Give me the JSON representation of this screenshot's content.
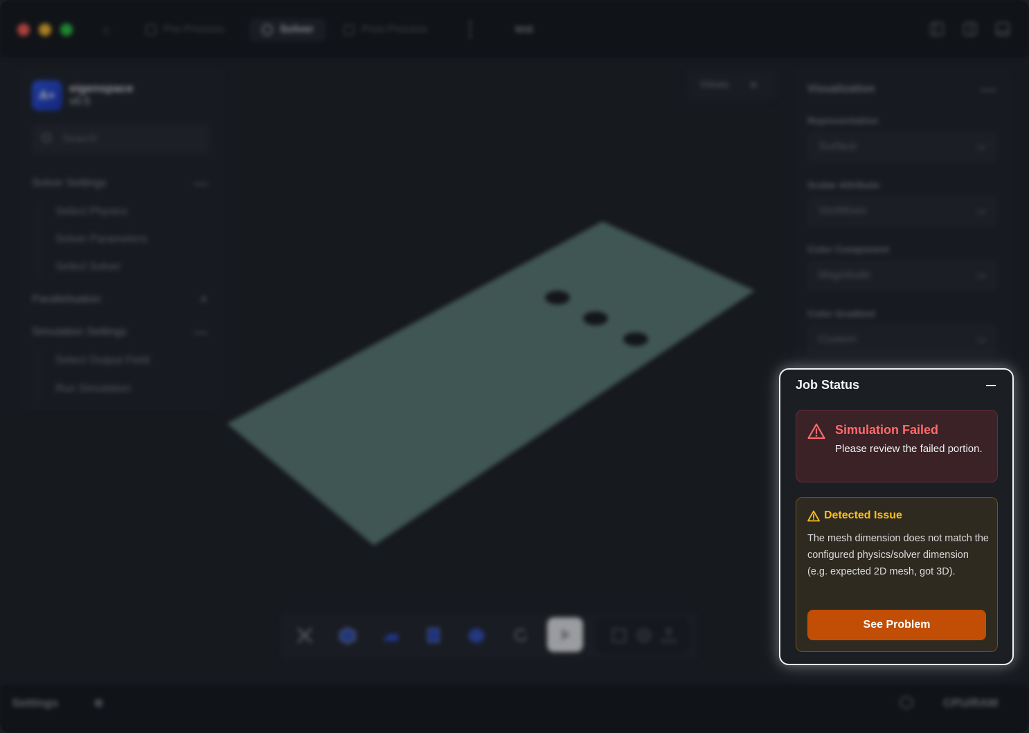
{
  "titlebar": {
    "tabs": [
      {
        "label": "Pre-Process"
      },
      {
        "label": "Solver"
      },
      {
        "label": "Post-Process"
      }
    ],
    "project_title": "test"
  },
  "sidebar": {
    "app_name": "eigenspace",
    "version": "v0.5",
    "logo_text": "A+",
    "search_placeholder": "Search",
    "sections": [
      {
        "title": "Solver Settings",
        "expanded": true,
        "items": [
          "Select Physics",
          "Solver Parameters",
          "Select Solver"
        ]
      },
      {
        "title": "Parallelisation",
        "expanded": false,
        "items": []
      },
      {
        "title": "Simulation Settings",
        "expanded": true,
        "items": [
          "Select Output Field",
          "Run Simulation"
        ]
      }
    ]
  },
  "viewport": {
    "views_label": "Views"
  },
  "visualization": {
    "title": "Visualization",
    "fields": [
      {
        "label": "Representation",
        "value": "Surface"
      },
      {
        "label": "Scalar Attribute",
        "value": "VonMises"
      },
      {
        "label": "Color Component",
        "value": "Magnitude"
      },
      {
        "label": "Color Gradient",
        "value": "Custom"
      }
    ]
  },
  "statusbar": {
    "settings_label": "Settings",
    "resources_label": "CPU/RAM"
  },
  "job_status": {
    "title": "Job Status",
    "error": {
      "title": "Simulation Failed",
      "message": "Please review the failed portion."
    },
    "issue": {
      "title": "Detected Issue",
      "message": "The mesh dimension does not match the configured physics/solver dimension (e.g. expected 2D mesh, got 3D).",
      "button_label": "See Problem"
    }
  },
  "colors": {
    "error_red": "#ff6b6b",
    "warning_yellow": "#ffbf1f",
    "button_orange": "#c24e06",
    "plate_teal": "#5f7f78"
  },
  "icons": {
    "tab_pre": "square-icon",
    "tab_solver": "cube-icon",
    "tab_post": "upload-icon",
    "error": "alert-triangle-icon",
    "warning": "alert-triangle-icon"
  }
}
